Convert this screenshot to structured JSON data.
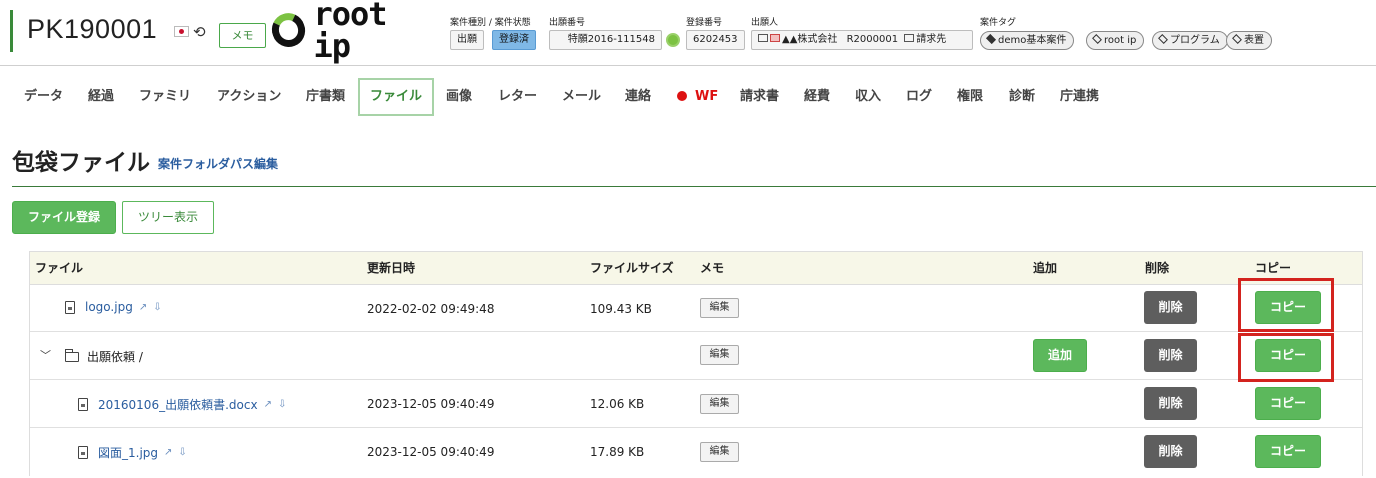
{
  "header": {
    "case_number": "PK190001",
    "memo_label": "メモ",
    "logo_text": "root ip",
    "case_type_label": "案件種別 / 案件状態",
    "case_type": "出願",
    "case_status": "登録済",
    "app_number_label": "出願番号",
    "app_number": "特願2016-111548",
    "reg_number_label": "登録番号",
    "reg_number": "6202453",
    "applicant_label": "出願人",
    "applicant_name": "▲▲株式会社",
    "applicant_code": "R2000001",
    "billing_label": "請求先",
    "case_tags_label": "案件タグ",
    "tags": [
      "demo基本案件",
      "root ip",
      "プログラム",
      "表置"
    ]
  },
  "tabs": [
    {
      "label": "データ"
    },
    {
      "label": "経過"
    },
    {
      "label": "ファミリ"
    },
    {
      "label": "アクション"
    },
    {
      "label": "庁書類"
    },
    {
      "label": "ファイル",
      "active": true
    },
    {
      "label": "画像"
    },
    {
      "label": "レター"
    },
    {
      "label": "メール"
    },
    {
      "label": "連絡"
    },
    {
      "label": "WF"
    },
    {
      "label": "請求書"
    },
    {
      "label": "経費"
    },
    {
      "label": "収入"
    },
    {
      "label": "ログ"
    },
    {
      "label": "権限"
    },
    {
      "label": "診断"
    },
    {
      "label": "庁連携"
    }
  ],
  "section": {
    "title": "包袋ファイル",
    "folder_path_link": "案件フォルダパス編集",
    "register_button": "ファイル登録",
    "tree_button": "ツリー表示"
  },
  "table": {
    "headers": {
      "file": "ファイル",
      "updated": "更新日時",
      "size": "ファイルサイズ",
      "memo": "メモ",
      "add": "追加",
      "delete": "削除",
      "copy": "コピー"
    },
    "edit_label": "編集",
    "add_label": "追加",
    "delete_label": "削除",
    "copy_label": "コピー",
    "rows": [
      {
        "name": "logo.jpg",
        "updated": "2022-02-02 09:49:48",
        "size": "109.43 KB"
      },
      {
        "name": "出願依頼 /",
        "updated": "",
        "size": ""
      },
      {
        "name": "20160106_出願依頼書.docx",
        "updated": "2023-12-05 09:40:49",
        "size": "12.06 KB"
      },
      {
        "name": "図面_1.jpg",
        "updated": "2023-12-05 09:40:49",
        "size": "17.89 KB"
      }
    ]
  },
  "colors": {
    "accent_green": "#5cb85c",
    "highlight_red": "#d3231e",
    "delete_gray": "#5e5e5e",
    "link_blue": "#2a5d9f"
  }
}
